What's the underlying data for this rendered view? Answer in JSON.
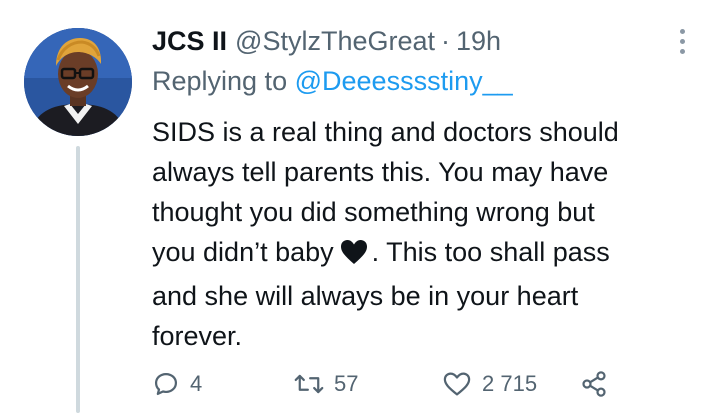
{
  "tweet": {
    "display_name": "JCS II",
    "handle": "@StylzTheGreat",
    "separator": "·",
    "time": "19h",
    "replying_prefix": "Replying to",
    "replying_to": "@Deeesssstiny__",
    "body_lines": {
      "line1": "SIDS is a real thing and doctors should",
      "line2": "always tell parents this. You may have",
      "line3": "thought you did something wrong but",
      "line4_before_emoji": "you didn’t baby",
      "line4_after_emoji": ". This too shall pass",
      "line5": "and she will always be in your heart",
      "line6": "forever."
    },
    "emoji": "black-heart-emoji"
  },
  "actions": {
    "reply_count": "4",
    "retweet_count": "57",
    "like_count": "2 715",
    "reply_icon": "reply-icon",
    "retweet_icon": "retweet-icon",
    "like_icon": "heart-icon",
    "share_icon": "share-icon"
  },
  "colors": {
    "text": "#0f1419",
    "secondary": "#536471",
    "link": "#1d9bf0",
    "thread_line": "#cfd9de"
  }
}
